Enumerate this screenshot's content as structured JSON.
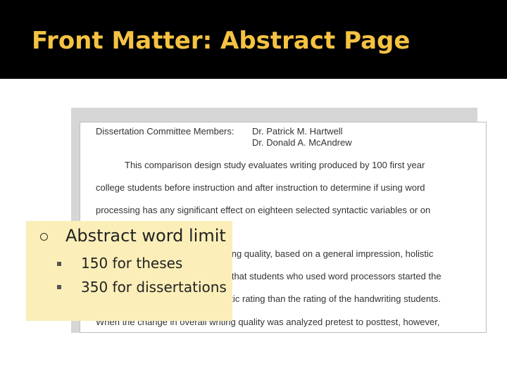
{
  "slide": {
    "title": "Front Matter: Abstract Page"
  },
  "document": {
    "committee_label": "Dissertation Committee Members:",
    "member_1": "Dr. Patrick M. Hartwell",
    "member_2": "Dr. Donald A. McAndrew",
    "lines": [
      "This comparison design study evaluates writing produced by 100 first year",
      "college students before instruction and after instruction to determine if using word",
      "processing has any significant effect on eighteen selected syntactic variables or on",
      "riting quality, based on a general impression, holistic",
      "d that students who used word processors started the",
      "istic rating than the rating of the handwriting students.",
      "When the change in overall writing quality was analyzed pretest to posttest, however,"
    ]
  },
  "callout": {
    "heading": "Abstract word limit",
    "items": [
      "150 for theses",
      "350 for dissertations"
    ]
  },
  "colors": {
    "title_bar": "#000000",
    "title_text": "#f5c242",
    "callout_bg": "#fbeeb8"
  }
}
